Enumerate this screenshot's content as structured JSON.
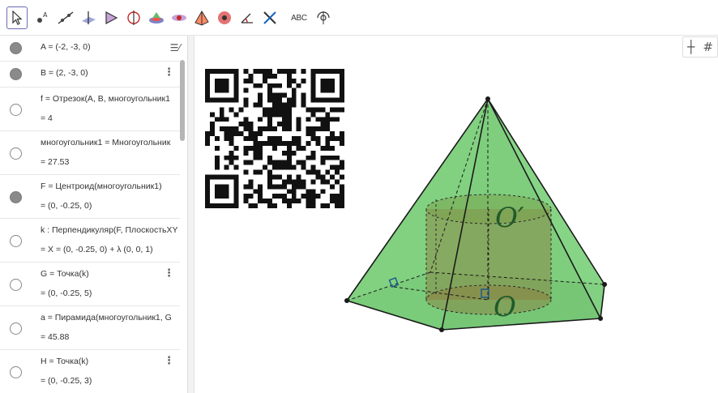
{
  "toolbar": {
    "tools": [
      {
        "name": "move-tool",
        "icon": "cursor-arrow-icon"
      },
      {
        "name": "point-tool",
        "icon": "point-icon"
      },
      {
        "name": "line-tool",
        "icon": "line-icon"
      },
      {
        "name": "perpendicular-tool",
        "icon": "perpendicular-icon"
      },
      {
        "name": "polygon-tool",
        "icon": "polygon-icon"
      },
      {
        "name": "circle-tool",
        "icon": "circle-icon"
      },
      {
        "name": "intersect-surfaces-tool",
        "icon": "intersect-surfaces-icon"
      },
      {
        "name": "plane-tool",
        "icon": "plane-icon"
      },
      {
        "name": "pyramid-tool",
        "icon": "pyramid-icon"
      },
      {
        "name": "sphere-tool",
        "icon": "sphere-icon"
      },
      {
        "name": "angle-tool",
        "icon": "angle-icon"
      },
      {
        "name": "reflect-tool",
        "icon": "reflect-icon"
      },
      {
        "name": "text-tool",
        "icon": "text-icon",
        "label": "ABC"
      },
      {
        "name": "rotate-view-tool",
        "icon": "rotate-view-icon"
      }
    ]
  },
  "algebra": {
    "rows": [
      {
        "line1": "A  =  (-2, -3, 0)",
        "line2": "",
        "visible": true
      },
      {
        "line1": "B  =  (2, -3, 0)",
        "line2": "",
        "visible": true
      },
      {
        "line1": "f  =  Отрезок(A, B, многоугольник1",
        "line2": "=  4",
        "visible": false
      },
      {
        "line1": "многоугольник1  =  Многоугольник",
        "line2": "=  27.53",
        "visible": false
      },
      {
        "line1": "F  =  Центроид(многоугольник1)",
        "line2": "=  (0, -0.25, 0)",
        "visible": true
      },
      {
        "line1": "k : Перпендикуляр(F, ПлоскостьXY",
        "line2": "=  X = (0, -0.25, 0) + λ (0, 0, 1)",
        "visible": false
      },
      {
        "line1": "G  =  Точка(k)",
        "line2": "=  (0, -0.25, 5)",
        "visible": false
      },
      {
        "line1": "a  =  Пирамида(многоугольник1, G",
        "line2": "=  45.88",
        "visible": false
      },
      {
        "line1": "H  =  Точка(k)",
        "line2": "=  (0, -0.25, 3)",
        "visible": false
      }
    ],
    "sort_icon": "sort-icon",
    "menu_icon": "more-vert-icon"
  },
  "graphics": {
    "labels": {
      "top_center": "O′",
      "bottom_center": "O"
    },
    "buttons": [
      {
        "name": "axes-toggle",
        "glyph": "┼"
      },
      {
        "name": "grid-toggle",
        "glyph": "#"
      }
    ],
    "colors": {
      "pyramid_fill": "#4caf50",
      "cylinder_fill": "#8d7b3c",
      "edge": "#1a1a1a"
    }
  }
}
